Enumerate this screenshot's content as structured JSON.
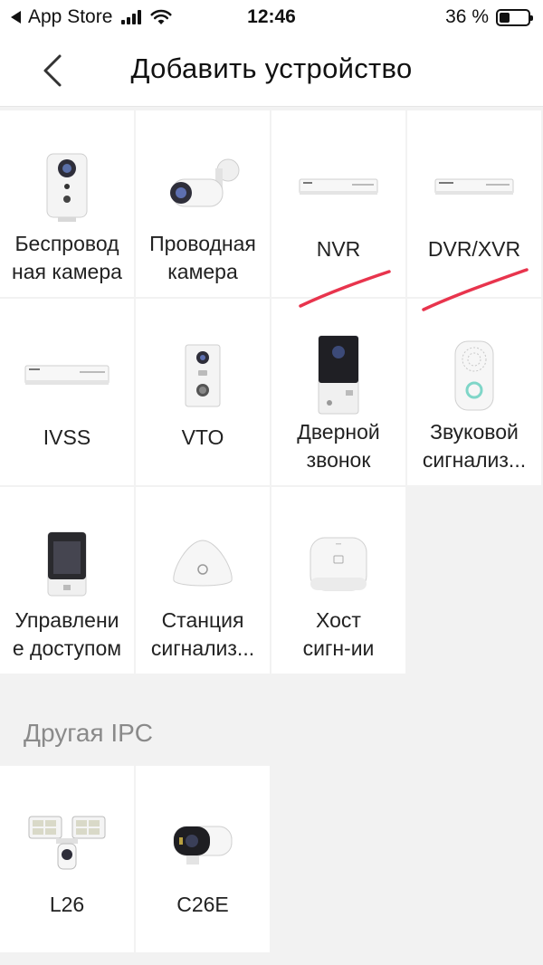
{
  "status_bar": {
    "back_app": "App Store",
    "time": "12:46",
    "battery_percent": "36 %",
    "battery_level": 0.36
  },
  "nav": {
    "title": "Добавить устройство"
  },
  "devices": [
    {
      "label": "Беспровод\nная камера",
      "icon": "wireless-camera-icon"
    },
    {
      "label": "Проводная\nкамера",
      "icon": "bullet-camera-icon"
    },
    {
      "label": "NVR",
      "icon": "nvr-recorder-icon"
    },
    {
      "label": "DVR/XVR",
      "icon": "dvr-recorder-icon"
    },
    {
      "label": "IVSS",
      "icon": "ivss-recorder-icon"
    },
    {
      "label": "VTO",
      "icon": "vto-intercom-icon"
    },
    {
      "label": "Дверной\nзвонок",
      "icon": "doorbell-icon"
    },
    {
      "label": "Звуковой\nсигнализ...",
      "icon": "siren-icon"
    },
    {
      "label": "Управлени\nе доступом",
      "icon": "access-control-icon"
    },
    {
      "label": "Станция\nсигнализ...",
      "icon": "alarm-station-icon"
    },
    {
      "label": "Хост\nсигн-ии",
      "icon": "alarm-hub-icon"
    }
  ],
  "other_section": {
    "title": "Другая IPC",
    "devices": [
      {
        "label": "L26",
        "icon": "floodlight-camera-icon"
      },
      {
        "label": "C26E",
        "icon": "c26e-camera-icon"
      }
    ]
  },
  "colors": {
    "background": "#f2f2f2",
    "tile": "#ffffff",
    "annotation_red": "#e8344d",
    "section_gray": "#8a8a8a"
  }
}
